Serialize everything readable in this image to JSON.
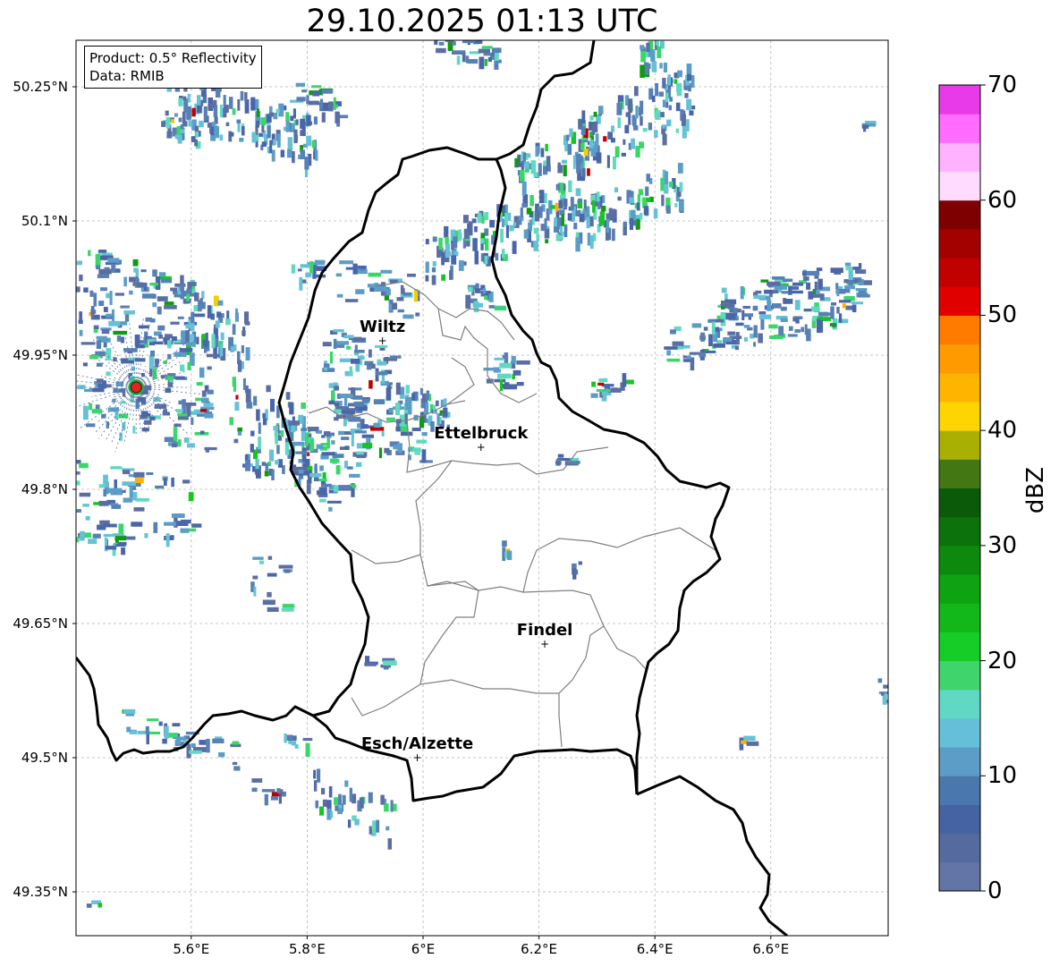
{
  "title": "29.10.2025 01:13 UTC",
  "info_box": {
    "product": "Product: 0.5° Reflectivity",
    "data": "Data: RMIB"
  },
  "colorbar": {
    "label": "dBZ",
    "ticks": [
      "0",
      "10",
      "20",
      "30",
      "40",
      "50",
      "60",
      "70"
    ],
    "range": [
      0,
      70
    ],
    "colors": [
      "#6375a6",
      "#556b9f",
      "#4563a3",
      "#4a77ae",
      "#5b9dc6",
      "#65bfd8",
      "#60d8c4",
      "#3fd46c",
      "#16cc26",
      "#12b819",
      "#0ea311",
      "#0d8a0e",
      "#0b720c",
      "#0a5a0a",
      "#437714",
      "#aab003",
      "#ffd500",
      "#ffb400",
      "#ff9a00",
      "#ff7b00",
      "#e00000",
      "#c10000",
      "#a30000",
      "#7f0000",
      "#ffdcff",
      "#ffb2ff",
      "#ff6cff",
      "#e93ae9"
    ]
  },
  "axes": {
    "lat_ticks": [
      "50.25°N",
      "50.1°N",
      "49.95°N",
      "49.8°N",
      "49.65°N",
      "49.5°N",
      "49.35°N"
    ],
    "lon_ticks": [
      "5.6°E",
      "5.8°E",
      "6°E",
      "6.2°E",
      "6.4°E",
      "6.6°E"
    ]
  },
  "cities": [
    {
      "name": "Wiltz",
      "lon": 5.93,
      "lat": 49.966
    },
    {
      "name": "Ettelbruck",
      "lon": 6.1,
      "lat": 49.847
    },
    {
      "name": "Findel",
      "lon": 6.21,
      "lat": 49.627
    },
    {
      "name": "Esch/Alzette",
      "lon": 5.99,
      "lat": 49.5
    }
  ],
  "radar_site": {
    "lon": 5.505,
    "lat": 49.914
  }
}
